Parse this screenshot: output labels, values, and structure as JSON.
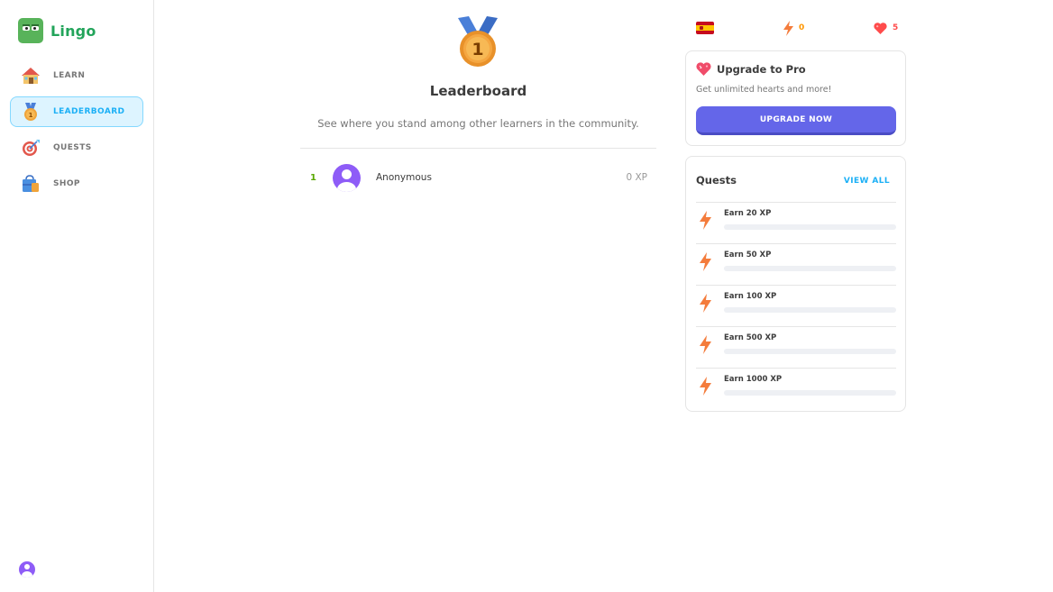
{
  "app": {
    "name": "Lingo"
  },
  "sidebar": {
    "items": [
      {
        "label": "LEARN",
        "icon": "house-icon",
        "active": false
      },
      {
        "label": "LEADERBOARD",
        "icon": "medal-icon",
        "active": true
      },
      {
        "label": "QUESTS",
        "icon": "target-icon",
        "active": false
      },
      {
        "label": "SHOP",
        "icon": "shop-icon",
        "active": false
      }
    ],
    "user_avatar": "user-avatar-icon"
  },
  "main": {
    "badge_icon": "medal-icon",
    "badge_number": "1",
    "title": "Leaderboard",
    "subtitle": "See where you stand among other learners in the community.",
    "rows": [
      {
        "rank": "1",
        "name": "Anonymous",
        "xp": "0 XP"
      }
    ]
  },
  "topbar": {
    "language_flag": "spain-flag-icon",
    "points": "0",
    "hearts": "5"
  },
  "pro_card": {
    "title": "Upgrade to Pro",
    "description": "Get unlimited hearts and more!",
    "button_label": "UPGRADE NOW"
  },
  "quests_card": {
    "title": "Quests",
    "view_all_label": "VIEW ALL",
    "items": [
      {
        "label": "Earn 20 XP",
        "progress": 0
      },
      {
        "label": "Earn 50 XP",
        "progress": 0
      },
      {
        "label": "Earn 100 XP",
        "progress": 0
      },
      {
        "label": "Earn 500 XP",
        "progress": 0
      },
      {
        "label": "Earn 1000 XP",
        "progress": 0
      }
    ]
  },
  "colors": {
    "brand_green": "#22a45a",
    "active_blue": "#1cb0f6",
    "upgrade_button": "#6466e9",
    "bolt_orange": "#ff9600",
    "heart_red": "#ff4b4b"
  }
}
